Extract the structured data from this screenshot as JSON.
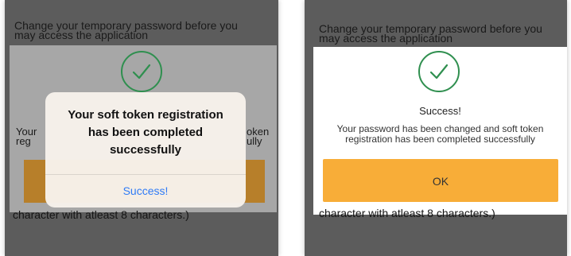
{
  "left_screen": {
    "background_title": "Change your temporary password before you may access the application",
    "background_dialog": {
      "text_left": "Your\nreg",
      "text_right": "oken\nully"
    },
    "footer_text": "character with atleast 8 characters.)",
    "alert": {
      "message_lines": [
        "Your soft token registration",
        "has been completed",
        "successfully"
      ],
      "action_label": "Success!"
    }
  },
  "right_screen": {
    "background_title": "Change your temporary password before you may access the application",
    "dialog": {
      "icon": "check-circle-icon",
      "title": "Success!",
      "message_lines": [
        "Your password has been changed and soft token",
        "registration has been completed successfully"
      ],
      "ok_label": "OK"
    },
    "footer_text": "character with atleast 8 characters.)"
  },
  "colors": {
    "overlay": "#5c5c5c",
    "accent_orange": "#f8ad38",
    "check_green": "#2f8f4f",
    "ios_blue": "#2f7bf6"
  }
}
